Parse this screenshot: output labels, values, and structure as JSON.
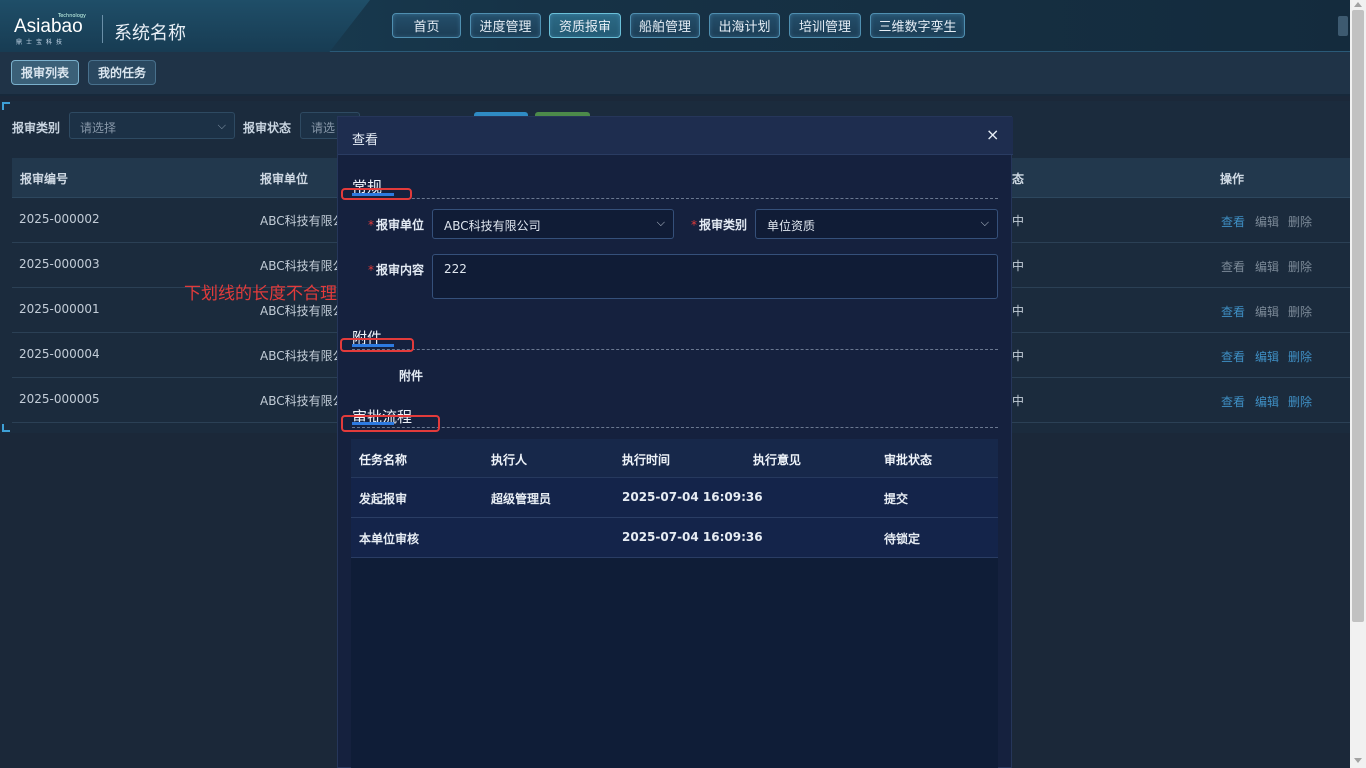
{
  "header": {
    "logo_main": "Asiabao",
    "logo_tech": "Technology",
    "logo_sub": "鼎士宝科技",
    "system_name": "系统名称",
    "nav": [
      "首页",
      "进度管理",
      "资质报审",
      "船舶管理",
      "出海计划",
      "培训管理",
      "三维数字孪生"
    ],
    "active_nav": "资质报审"
  },
  "tabs": [
    "报审列表",
    "我的任务"
  ],
  "filters": {
    "category_label": "报审类别",
    "category_placeholder": "请选择",
    "status_label": "报审状态",
    "status_placeholder": "请选"
  },
  "table": {
    "headers": [
      "报审编号",
      "报审单位",
      "状态",
      "操作"
    ],
    "rows": [
      {
        "id": "2025-000002",
        "unit": "ABC科技有限公",
        "status": "中"
      },
      {
        "id": "2025-000003",
        "unit": "ABC科技有限公",
        "status": "中"
      },
      {
        "id": "2025-000001",
        "unit": "ABC科技有限公",
        "status": "中"
      },
      {
        "id": "2025-000004",
        "unit": "ABC科技有限公",
        "status": "中"
      },
      {
        "id": "2025-000005",
        "unit": "ABC科技有限公",
        "status": "中"
      }
    ],
    "actions": [
      "查看",
      "编辑",
      "删除"
    ]
  },
  "annotation": "下划线的长度不合理",
  "modal": {
    "title": "查看",
    "close": "×",
    "section_general": "常规",
    "unit_label": "报审单位",
    "unit_value": "ABC科技有限公司",
    "category_label": "报审类别",
    "category_value": "单位资质",
    "content_label": "报审内容",
    "content_value": "222",
    "section_attach": "附件",
    "attach_label": "附件",
    "section_flow": "审批流程",
    "flow_headers": [
      "任务名称",
      "执行人",
      "执行时间",
      "执行意见",
      "审批状态"
    ],
    "flow_rows": [
      {
        "task": "发起报审",
        "executor": "超级管理员",
        "time": "2025-07-04 16:09:36",
        "opinion": "",
        "status": "提交"
      },
      {
        "task": "本单位审核",
        "executor": "",
        "time": "2025-07-04 16:09:36",
        "opinion": "",
        "status": "待锁定"
      }
    ]
  },
  "colors": {
    "accent": "#3f8fc4",
    "annotation": "#e23b3b",
    "underline": "#2d7ae0"
  }
}
